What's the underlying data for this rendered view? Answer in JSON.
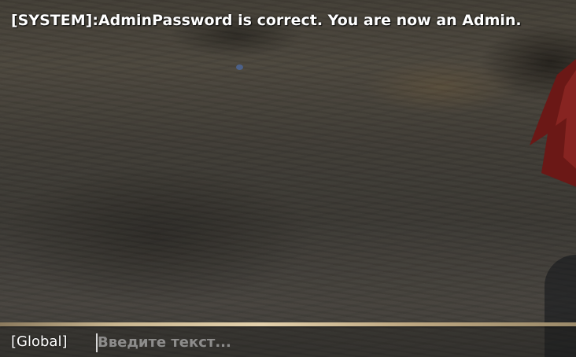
{
  "chat": {
    "messages": [
      {
        "text": "[SYSTEM]:AdminPassword is correct. You are now an Admin."
      }
    ],
    "channel_label": "[Global]",
    "input": {
      "value": "",
      "placeholder": "Введите текст..."
    }
  },
  "colors": {
    "message_text": "#ffffff",
    "placeholder_text": "#b4b4b4",
    "bar_border": "#d8c7a3"
  }
}
